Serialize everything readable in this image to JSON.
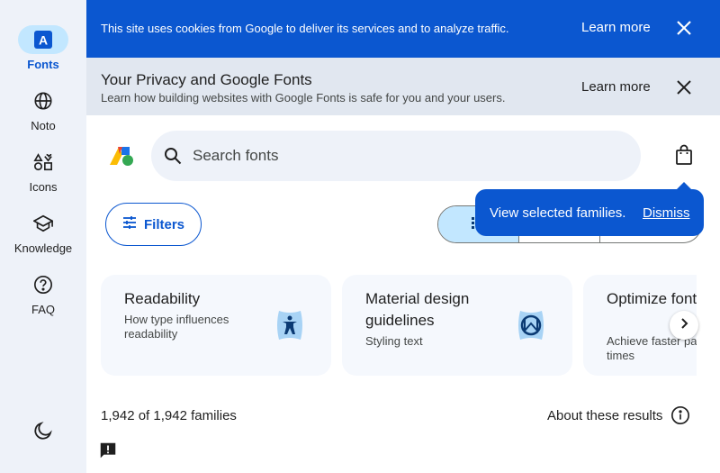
{
  "nav": {
    "items": [
      {
        "label": "Fonts",
        "icon": "font-a-icon",
        "active": true
      },
      {
        "label": "Noto",
        "icon": "globe-icon",
        "active": false
      },
      {
        "label": "Icons",
        "icon": "shapes-icon",
        "active": false
      },
      {
        "label": "Knowledge",
        "icon": "school-icon",
        "active": false
      },
      {
        "label": "FAQ",
        "icon": "help-icon",
        "active": false
      }
    ],
    "theme_icon": "dark-mode-icon",
    "feedback_icon": "feedback-icon"
  },
  "cookie_banner": {
    "text": "This site uses cookies from Google to deliver its services and to analyze traffic.",
    "learn_more": "Learn more"
  },
  "privacy_banner": {
    "title": "Your Privacy and Google Fonts",
    "subtitle": "Learn how building websites with Google Fonts is safe for you and your users.",
    "learn_more": "Learn more"
  },
  "search": {
    "placeholder": "Search fonts"
  },
  "filters": {
    "label": "Filters"
  },
  "tooltip": {
    "text": "View selected families.",
    "dismiss": "Dismiss"
  },
  "cards": [
    {
      "title": "Readability",
      "subtitle": "How type influences readability"
    },
    {
      "title": "Material design guidelines",
      "subtitle": "Styling text"
    },
    {
      "title": "Optimize font loading",
      "subtitle": "Achieve faster page times"
    }
  ],
  "results": {
    "count": "1,942 of 1,942 families",
    "about": "About these results"
  },
  "colors": {
    "accent": "#0b57d0",
    "rail_bg": "#eef2f9",
    "active_pill": "#c2e7ff"
  }
}
